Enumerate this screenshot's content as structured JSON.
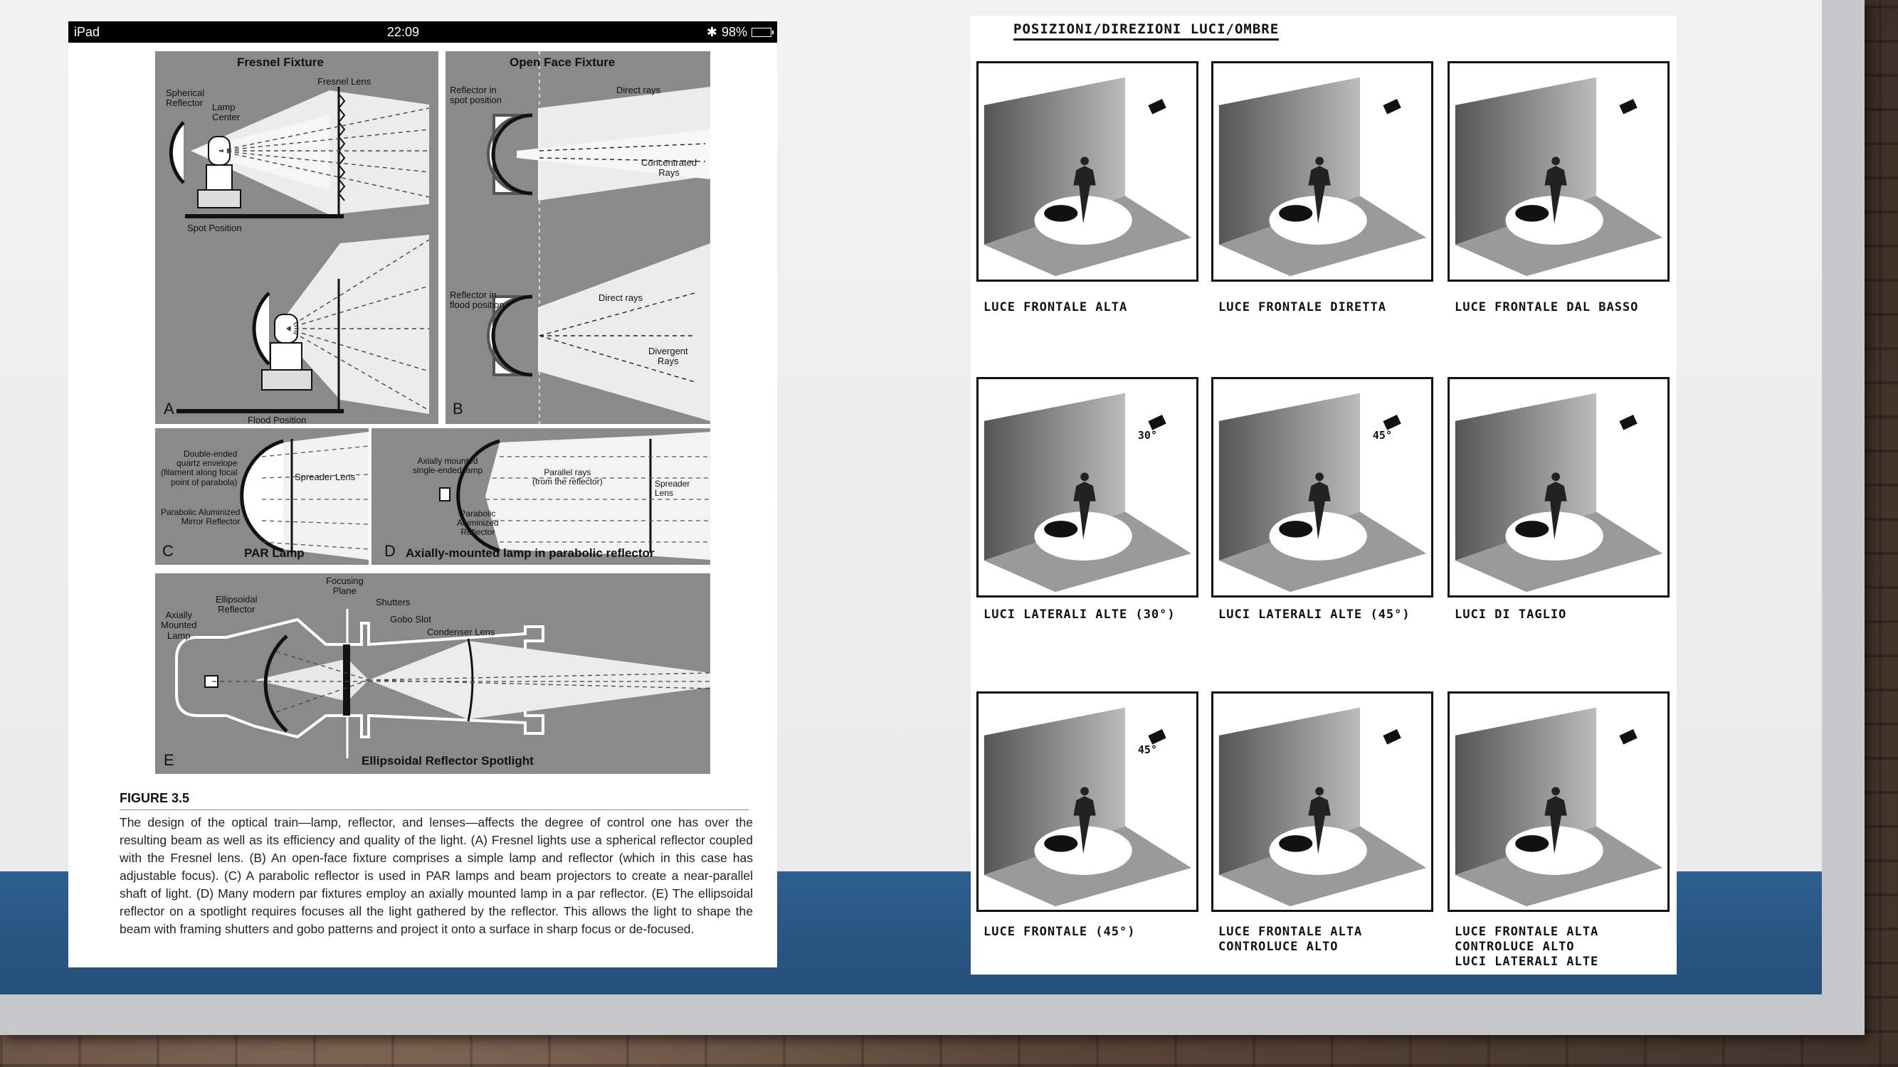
{
  "ipad": {
    "device": "iPad",
    "time": "22:09",
    "battery": "98%",
    "figure": {
      "fresnel": {
        "title": "Fresnel Fixture",
        "fresnel_lens": "Fresnel Lens",
        "spherical_reflector": "Spherical\nReflector",
        "lamp_center": "Lamp\nCenter",
        "spot_position": "Spot Position",
        "flood_position": "Flood Position",
        "letter": "A"
      },
      "open_face": {
        "title": "Open Face Fixture",
        "reflector_spot": "Reflector in\nspot position",
        "direct_rays_1": "Direct rays",
        "concentrated_rays": "Concentrated\nRays",
        "reflector_flood": "Reflector in\nflood position",
        "direct_rays_2": "Direct rays",
        "divergent_rays": "Divergent\nRays",
        "letter": "B"
      },
      "par": {
        "envelope": "Double-ended\nquartz envelope\n(filament along focal\npoint of parabola)",
        "spreader_lens": "Spreader Lens",
        "mirror": "Parabolic Aluminized\nMirror Reflector",
        "letter": "C",
        "title": "PAR Lamp"
      },
      "axial": {
        "axially_lamp": "Axially mounted\nsingle-ended lamp",
        "parallel_rays": "Parallel rays\n(from the reflector)",
        "spreader_lens": "Spreader Lens",
        "reflector": "Parabolic\nAluminized\nReflector",
        "letter": "D",
        "title": "Axially-mounted lamp in parabolic reflector"
      },
      "ellipsoidal": {
        "focusing_plane": "Focusing\nPlane",
        "ellipsoidal_reflector": "Ellipsoidal\nReflector",
        "shutters": "Shutters",
        "axially_lamp": "Axially\nMounted\nLamp",
        "gobo_slot": "Gobo Slot",
        "condenser_lens": "Condenser Lens",
        "letter": "E",
        "title": "Ellipsoidal Reflector Spotlight"
      }
    },
    "caption_title": "FIGURE 3.5",
    "caption_text": "The design of the optical train—lamp, reflector, and lenses—affects the degree of control one has over the resulting beam as well as its efficiency and quality of the light. (A) Fresnel lights use a spherical reflector coupled with the Fresnel lens. (B) An open-face fixture comprises a simple lamp and reflector (which in this case has adjustable focus). (C) A parabolic reflector is used in PAR lamps and beam projectors to create a near-parallel shaft of light. (D) Many modern par fixtures employ an axially mounted lamp in a par reflector. (E) The ellipsoidal reflector on a spotlight requires focuses all the light gathered by the reflector. This allows the light to shape the beam with framing shutters and gobo patterns and project it onto a surface in sharp focus or de-focused."
  },
  "sheet": {
    "header": "POSIZIONI/DIREZIONI LUCI/OMBRE",
    "cells": [
      {
        "label": "LUCE FRONTALE ALTA"
      },
      {
        "label": "LUCE FRONTALE DIRETTA"
      },
      {
        "label": "LUCE FRONTALE DAL BASSO"
      },
      {
        "label": "LUCI LATERALI ALTE (30°)",
        "angle": "30°"
      },
      {
        "label": "LUCI LATERALI ALTE (45°)",
        "angle": "45°"
      },
      {
        "label": "LUCI DI TAGLIO"
      },
      {
        "label": "LUCE FRONTALE (45°)",
        "angle": "45°"
      },
      {
        "label": "LUCE FRONTALE ALTA\nCONTROLUCE ALTO"
      },
      {
        "label": "LUCE FRONTALE ALTA\nCONTROLUCE ALTO\nLUCI LATERALI ALTE"
      }
    ]
  }
}
